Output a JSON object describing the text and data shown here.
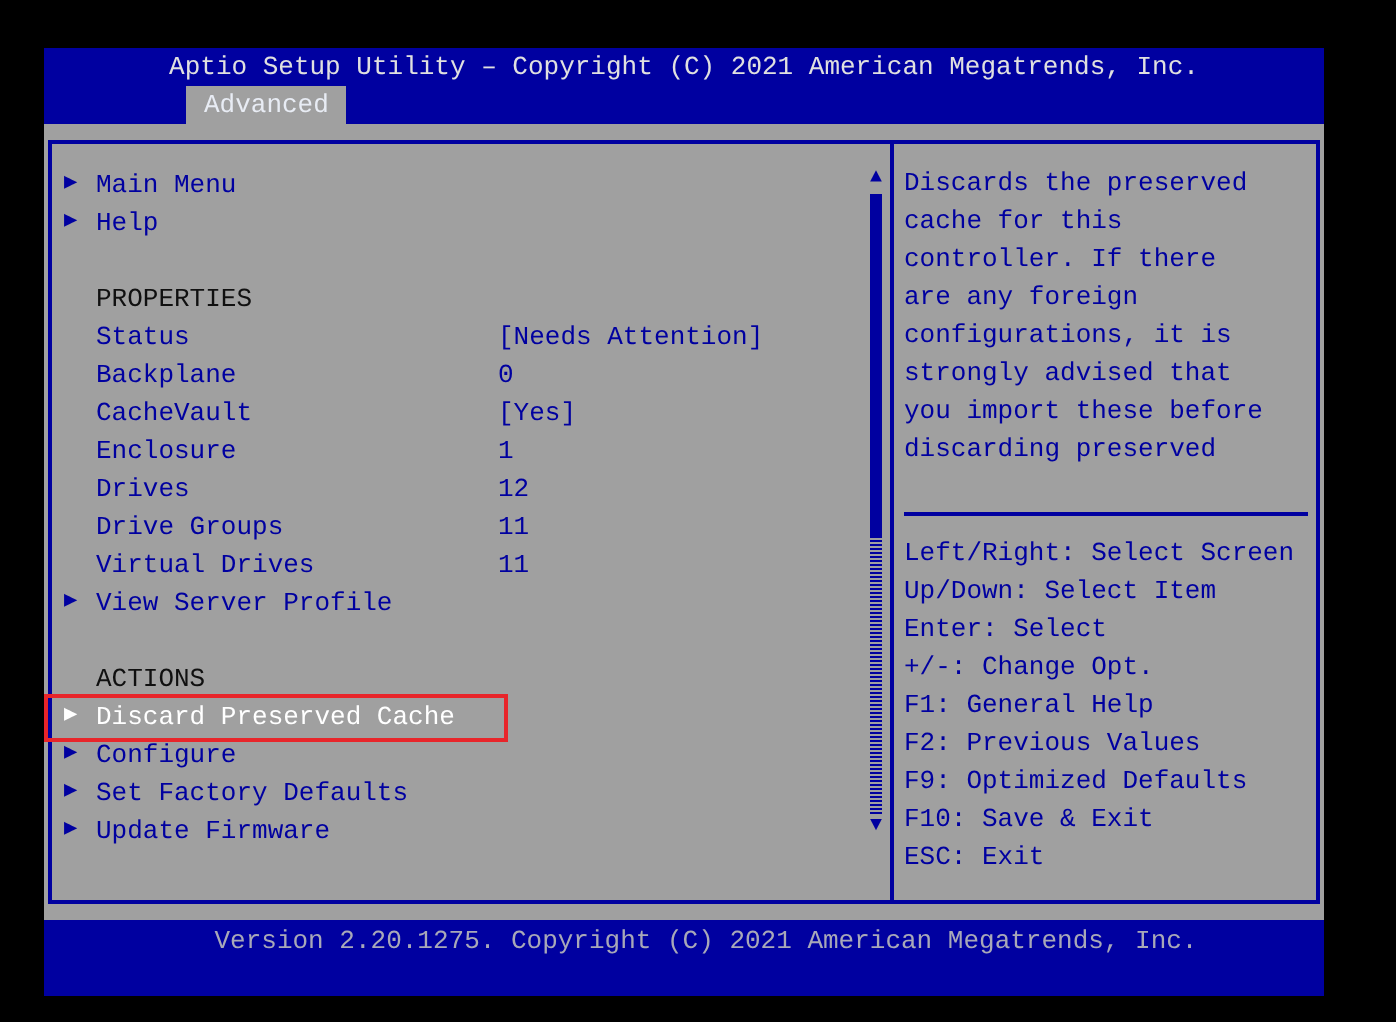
{
  "header": {
    "title": "Aptio Setup Utility – Copyright (C) 2021 American Megatrends, Inc.",
    "tabs": [
      {
        "label": "Advanced",
        "selected": true
      }
    ]
  },
  "menu": [
    {
      "kind": "link",
      "arrow": "▶",
      "label": "Main Menu",
      "selected": false
    },
    {
      "kind": "link",
      "arrow": "▶",
      "label": "Help",
      "selected": false
    },
    {
      "kind": "blank"
    },
    {
      "kind": "heading",
      "label": "PROPERTIES"
    },
    {
      "kind": "property",
      "label": "Status",
      "value": "[Needs Attention]"
    },
    {
      "kind": "property",
      "label": "Backplane",
      "value": "0"
    },
    {
      "kind": "property",
      "label": "CacheVault",
      "value": "[Yes]"
    },
    {
      "kind": "property",
      "label": "Enclosure",
      "value": "1"
    },
    {
      "kind": "property",
      "label": "Drives",
      "value": "12"
    },
    {
      "kind": "property",
      "label": "Drive Groups",
      "value": "11"
    },
    {
      "kind": "property",
      "label": "Virtual Drives",
      "value": "11"
    },
    {
      "kind": "link",
      "arrow": "▶",
      "label": "View Server Profile",
      "selected": false
    },
    {
      "kind": "blank"
    },
    {
      "kind": "heading",
      "label": "ACTIONS"
    },
    {
      "kind": "link",
      "arrow": "▶",
      "label": "Discard Preserved Cache",
      "selected": true,
      "highlighted": true
    },
    {
      "kind": "link",
      "arrow": "▶",
      "label": "Configure",
      "selected": false
    },
    {
      "kind": "link",
      "arrow": "▶",
      "label": "Set Factory Defaults",
      "selected": false
    },
    {
      "kind": "link",
      "arrow": "▶",
      "label": "Update Firmware",
      "selected": false
    }
  ],
  "scroll_arrows": {
    "up": "▲",
    "down": "▼"
  },
  "description_lines": [
    "Discards the preserved",
    "cache for this",
    "controller. If there",
    "are any foreign",
    "configurations, it is",
    "strongly advised that",
    "you import these before",
    "discarding preserved"
  ],
  "key_help": [
    "Left/Right: Select Screen",
    "Up/Down: Select Item",
    "Enter: Select",
    "+/-: Change Opt.",
    "F1: General Help",
    "F2: Previous Values",
    "F9: Optimized Defaults",
    "F10: Save & Exit",
    "ESC: Exit"
  ],
  "footer": "Version 2.20.1275. Copyright (C) 2021 American Megatrends, Inc."
}
